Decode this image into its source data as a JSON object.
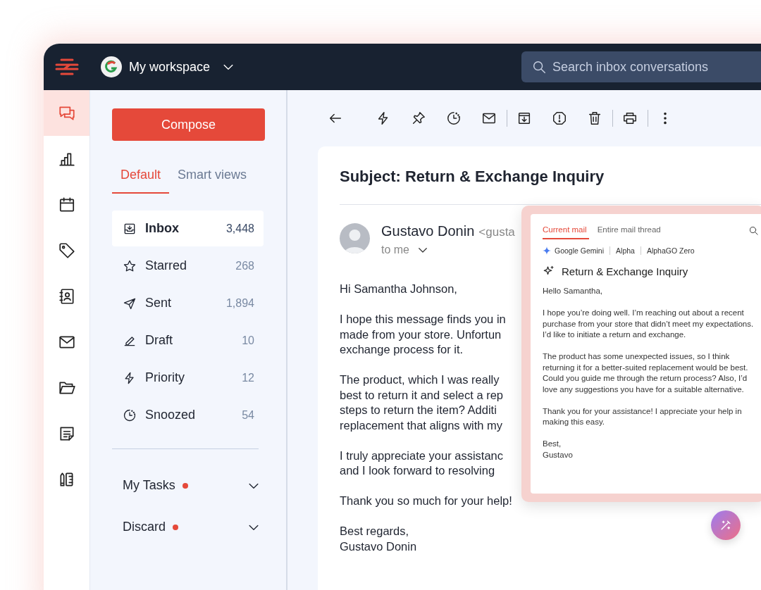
{
  "app_bar": {
    "workspace": "My workspace",
    "search": {
      "placeholder": "Search inbox conversations"
    }
  },
  "rail": [
    {
      "kind": "chat",
      "selected": true
    },
    {
      "kind": "chart",
      "selected": false
    },
    {
      "kind": "calendar",
      "selected": false
    },
    {
      "kind": "tag",
      "selected": false
    },
    {
      "kind": "contacts",
      "selected": false
    },
    {
      "kind": "mail",
      "selected": false
    },
    {
      "kind": "folder",
      "selected": false
    },
    {
      "kind": "note",
      "selected": false
    },
    {
      "kind": "tools",
      "selected": false
    }
  ],
  "compose": "Compose",
  "tabs": [
    {
      "label": "Default",
      "selected": true
    },
    {
      "label": "Smart views",
      "selected": false
    }
  ],
  "folders": [
    {
      "kind": "inbox",
      "label": "Inbox",
      "count": "3,448",
      "selected": true
    },
    {
      "kind": "star",
      "label": "Starred",
      "count": "268",
      "selected": false
    },
    {
      "kind": "send",
      "label": "Sent",
      "count": "1,894",
      "selected": false
    },
    {
      "kind": "draft",
      "label": "Draft",
      "count": "10",
      "selected": false
    },
    {
      "kind": "bolt",
      "label": "Priority",
      "count": "12",
      "selected": false
    },
    {
      "kind": "snooze",
      "label": "Snoozed",
      "count": "54",
      "selected": false
    }
  ],
  "sections": [
    {
      "label": "My Tasks",
      "unread": true
    },
    {
      "label": "Discard",
      "unread": true
    }
  ],
  "toolbar": [
    {
      "kind": "back"
    },
    {
      "kind": "space"
    },
    {
      "kind": "bolt"
    },
    {
      "kind": "pin"
    },
    {
      "kind": "snooze"
    },
    {
      "kind": "mail"
    },
    {
      "kind": "divider"
    },
    {
      "kind": "archive"
    },
    {
      "kind": "report"
    },
    {
      "kind": "trash"
    },
    {
      "kind": "divider"
    },
    {
      "kind": "print"
    },
    {
      "kind": "divider"
    },
    {
      "kind": "more"
    }
  ],
  "message": {
    "subject": "Subject: Return & Exchange Inquiry",
    "sender": {
      "name": "Gustavo Donin",
      "address": "<gusta",
      "recipient": "to me"
    },
    "body": [
      [
        "Hi Samantha Johnson,"
      ],
      [
        "I hope this message finds you in",
        "made from your store. Unfortun",
        "exchange process for it."
      ],
      [
        "The product, which I was really",
        "best to return it and select a rep",
        "steps to return the item? Additi",
        "replacement that aligns with my"
      ],
      [
        "I truly appreciate your assistanc",
        "and I look forward to resolving"
      ],
      [
        "Thank you so much for your help!"
      ],
      [
        "Best regards,",
        "Gustavo Donin"
      ]
    ]
  },
  "assistant": {
    "tabs": [
      {
        "label": "Current mail",
        "selected": true
      },
      {
        "label": "Entire mail thread",
        "selected": false
      }
    ],
    "models": [
      "Google Gemini",
      "Alpha",
      "AlphaGO Zero"
    ],
    "title": "Return & Exchange Inquiry",
    "body": [
      [
        "Hello Samantha,"
      ],
      [
        "I hope you’re doing well. I’m reaching out about a recent purchase from your store that didn’t meet my expectations. I’d like to initiate a return and exchange."
      ],
      [
        "The product has some unexpected issues, so I think returning it for a better-suited replacement would be best. Could you guide me through the return process? Also, I’d love any suggestions you have for a suitable alternative."
      ],
      [
        "Thank you for your assistance! I appreciate your help in making this easy."
      ],
      [
        "Best,",
        "Gustavo"
      ]
    ]
  }
}
